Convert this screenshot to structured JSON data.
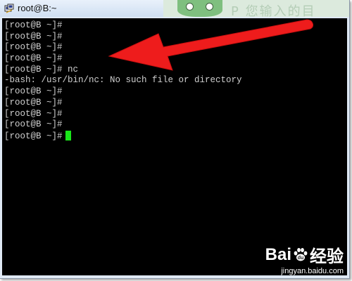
{
  "window": {
    "title": "root@B:~",
    "title_icon": "putty-terminal-icon"
  },
  "background": {
    "text": "P    您输入的目"
  },
  "terminal": {
    "lines": [
      "[root@B ~]#",
      "[root@B ~]#",
      "[root@B ~]#",
      "[root@B ~]#",
      "[root@B ~]# nc",
      "-bash: /usr/bin/nc: No such file or directory",
      "[root@B ~]#",
      "[root@B ~]#",
      "[root@B ~]#",
      "[root@B ~]#",
      "[root@B ~]#"
    ],
    "text_color": "#cfcfcf",
    "background_color": "#000000",
    "cursor_color": "#19e619"
  },
  "annotation": {
    "arrow_color": "#ee1c1c",
    "icon": "red-arrow-icon"
  },
  "watermark": {
    "logo_prefix": "Bai",
    "logo_suffix": "经验",
    "url": "jingyan.baidu.com",
    "icon": "baidu-paw-icon"
  }
}
